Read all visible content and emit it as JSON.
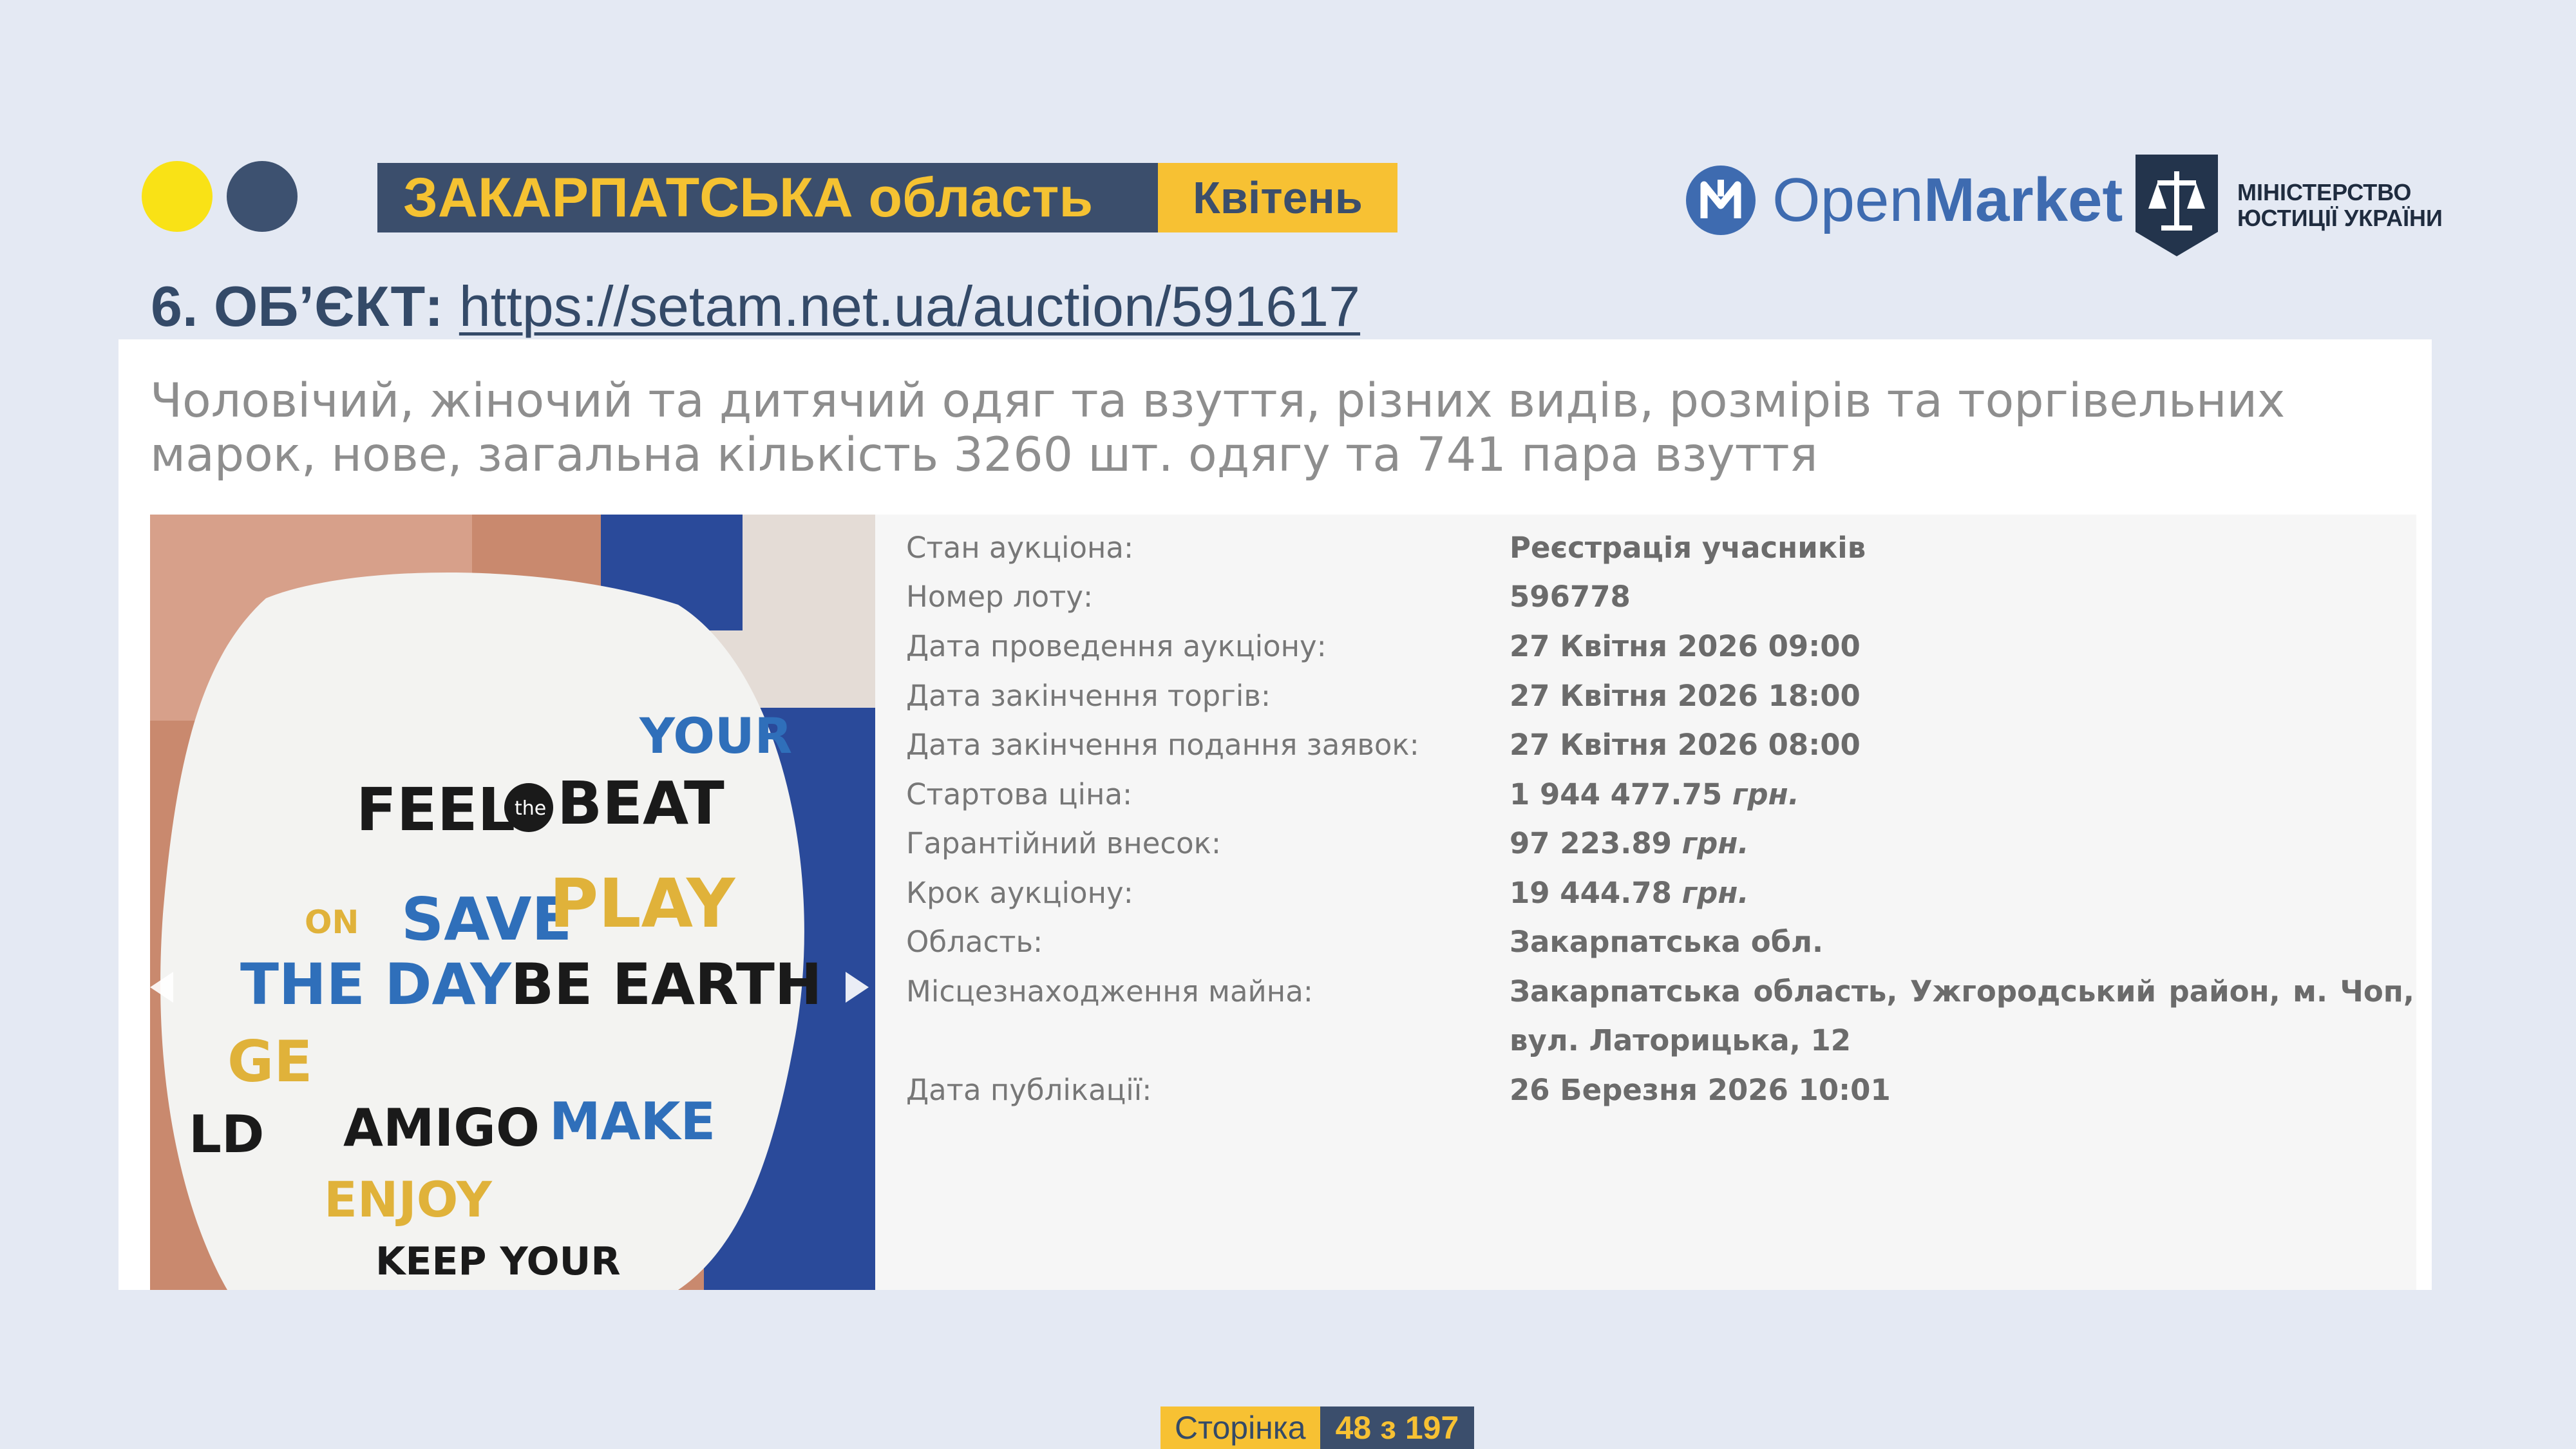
{
  "header": {
    "region": "ЗАКАРПАТСЬКА область",
    "month": "Квітень",
    "openmarket_brand": {
      "open": "Open",
      "market": "Market"
    },
    "ministry": {
      "line1": "МІНІСТЕРСТВО",
      "line2": "ЮСТИЦІЇ УКРАЇНИ"
    }
  },
  "object": {
    "label": "6. ОБ’ЄКТ:",
    "url": "https://setam.net.ua/auction/591617"
  },
  "lot": {
    "description": "Чоловічий, жіночий та дитячий одяг та взуття, різних видів, розмірів та торгівельних марок, нове, загальна кількість 3260 шт. одягу та 741 пара взуття",
    "photo_prints": [
      "FEEL",
      "the",
      "BEAT",
      "SAVE",
      "PLAY",
      "THE DAY",
      "BE EARTH",
      "AMIGO",
      "MAKE",
      "ENJOY",
      "KEEP YOUR",
      "YOUR",
      "ON",
      "GE",
      "LD"
    ],
    "details": [
      {
        "key": "Стан аукціона:",
        "value": "Реєстрація учасників",
        "unit": ""
      },
      {
        "key": "Номер лоту:",
        "value": "596778",
        "unit": ""
      },
      {
        "key": "Дата проведення аукціону:",
        "value": "27 Квітня 2026 09:00",
        "unit": ""
      },
      {
        "key": "Дата закінчення торгів:",
        "value": "27 Квітня 2026 18:00",
        "unit": ""
      },
      {
        "key": "Дата закінчення подання заявок:",
        "value": "27 Квітня 2026 08:00",
        "unit": ""
      },
      {
        "key": "Стартова ціна:",
        "value": "1 944 477.75",
        "unit": "грн."
      },
      {
        "key": "Гарантійний внесок:",
        "value": "97 223.89",
        "unit": "грн."
      },
      {
        "key": "Крок аукціону:",
        "value": "19 444.78",
        "unit": "грн."
      },
      {
        "key": "Область:",
        "value": "Закарпатська обл.",
        "unit": ""
      },
      {
        "key": "Місцезнаходження майна:",
        "value": "Закарпатська область, Ужгородський район, м. Чоп, вул. Латорицька, 12",
        "unit": ""
      },
      {
        "key": "Дата публікації:",
        "value": "26 Березня 2026 10:01",
        "unit": ""
      }
    ]
  },
  "footer": {
    "page_label": "Сторінка",
    "page_number": "48 з 197"
  },
  "colors": {
    "navy": "#3b4e6c",
    "yellow": "#f7c133",
    "dot_yellow": "#f9e216",
    "background": "#e4e9f3",
    "openmarket_blue": "#3e6bb0"
  }
}
